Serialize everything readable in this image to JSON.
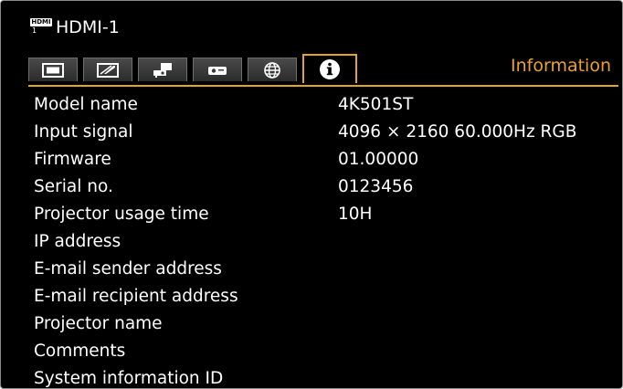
{
  "source": {
    "label": "HDMI-1",
    "icon": "hdmi-icon",
    "badge_text": "HDMI",
    "badge_number": "1"
  },
  "tabs": [
    {
      "name": "image-adjustment",
      "icon": "screen-icon"
    },
    {
      "name": "screen-settings",
      "icon": "slanted-screen-icon"
    },
    {
      "name": "installation",
      "icon": "projector-setup-icon"
    },
    {
      "name": "system",
      "icon": "projector-icon"
    },
    {
      "name": "network",
      "icon": "globe-icon"
    },
    {
      "name": "information",
      "icon": "info-icon",
      "active": true
    }
  ],
  "panel_title": "Information",
  "rows": [
    {
      "label": "Model name",
      "value": "4K501ST"
    },
    {
      "label": "Input signal",
      "value": "4096 × 2160 60.000Hz RGB"
    },
    {
      "label": "Firmware",
      "value": "01.00000"
    },
    {
      "label": "Serial no.",
      "value": "0123456"
    },
    {
      "label": "Projector usage time",
      "value": "10H"
    },
    {
      "label": "IP address",
      "value": ""
    },
    {
      "label": "E-mail sender address",
      "value": ""
    },
    {
      "label": "E-mail recipient address",
      "value": ""
    },
    {
      "label": "Projector name",
      "value": ""
    },
    {
      "label": "Comments",
      "value": ""
    },
    {
      "label": "System information ID",
      "value": ""
    }
  ],
  "colors": {
    "accent": "#e4a42a",
    "background": "#000000",
    "text": "#ffffff",
    "tab": "#3a3a3a"
  }
}
